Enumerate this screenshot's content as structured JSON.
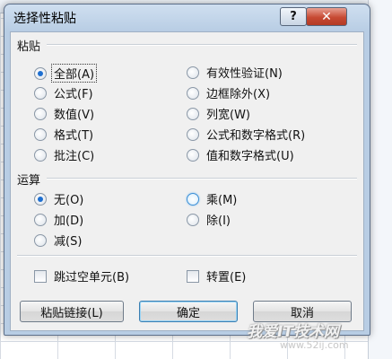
{
  "dialog": {
    "title": "选择性粘贴",
    "help_label": "?",
    "close_label": "✕"
  },
  "paste": {
    "group_label": "粘贴",
    "selected": "全部(A)",
    "left_options": [
      "全部(A)",
      "公式(F)",
      "数值(V)",
      "格式(T)",
      "批注(C)"
    ],
    "right_options": [
      "有效性验证(N)",
      "边框除外(X)",
      "列宽(W)",
      "公式和数字格式(R)",
      "值和数字格式(U)"
    ]
  },
  "operation": {
    "group_label": "运算",
    "selected": "无(O)",
    "left_options": [
      "无(O)",
      "加(D)",
      "减(S)"
    ],
    "right_options": [
      "乘(M)",
      "除(I)"
    ]
  },
  "checkboxes": {
    "skip_blanks": {
      "label": "跳过空单元(B)",
      "checked": false
    },
    "transpose": {
      "label": "转置(E)",
      "checked": false
    }
  },
  "buttons": {
    "paste_link": "粘贴链接(L)",
    "ok": "确定",
    "cancel": "取消"
  },
  "watermark": {
    "text": "我爱IT技术网",
    "url": "www.52ij.com"
  }
}
